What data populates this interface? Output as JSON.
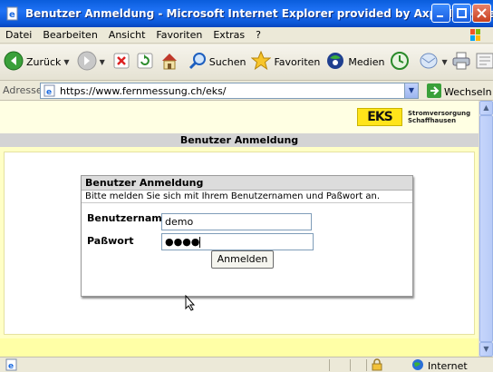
{
  "window": {
    "title": "Benutzer Anmeldung - Microsoft Internet Explorer provided by Axpo Informatik"
  },
  "menu": [
    "Datei",
    "Bearbeiten",
    "Ansicht",
    "Favoriten",
    "Extras",
    "?"
  ],
  "toolbar": {
    "back": "Zurück",
    "search": "Suchen",
    "favorites": "Favoriten",
    "media": "Medien"
  },
  "address": {
    "label": "Adresse",
    "url": "https://www.fernmessung.ch/eks/",
    "go": "Wechseln zu"
  },
  "page": {
    "logo_text": "EKS",
    "logo_line1": "Stromversorgung",
    "logo_line2": "Schaffhausen",
    "heading": "Benutzer Anmeldung",
    "panel_title": "Benutzer Anmeldung",
    "instruction": "Bitte melden Sie sich mit Ihrem Benutzernamen und Paßwort an.",
    "username_label": "Benutzername",
    "username_value": "demo",
    "password_label": "Paßwort",
    "password_value": "●●●●",
    "submit": "Anmelden"
  },
  "status": {
    "zone": "Internet"
  },
  "colors": {
    "titlebar": "#0b56d6",
    "page_background": "#ffffc6",
    "logo_yellow": "#ffe41a"
  }
}
